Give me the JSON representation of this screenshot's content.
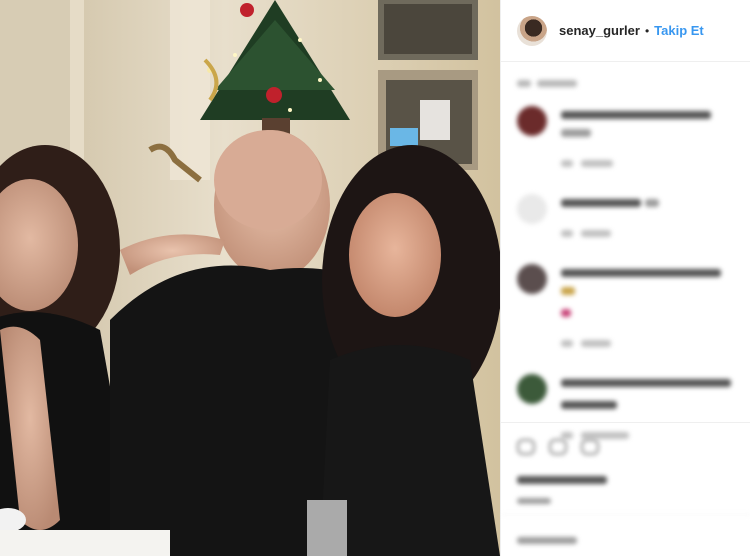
{
  "post": {
    "username": "senay_gurler",
    "separator": "•",
    "follow_label": "Takip Et"
  },
  "colors": {
    "follow": "#3897f0",
    "text": "#262626",
    "divider": "#efefef"
  },
  "icons": [
    "heart-icon",
    "comment-icon",
    "share-icon",
    "bookmark-icon"
  ]
}
